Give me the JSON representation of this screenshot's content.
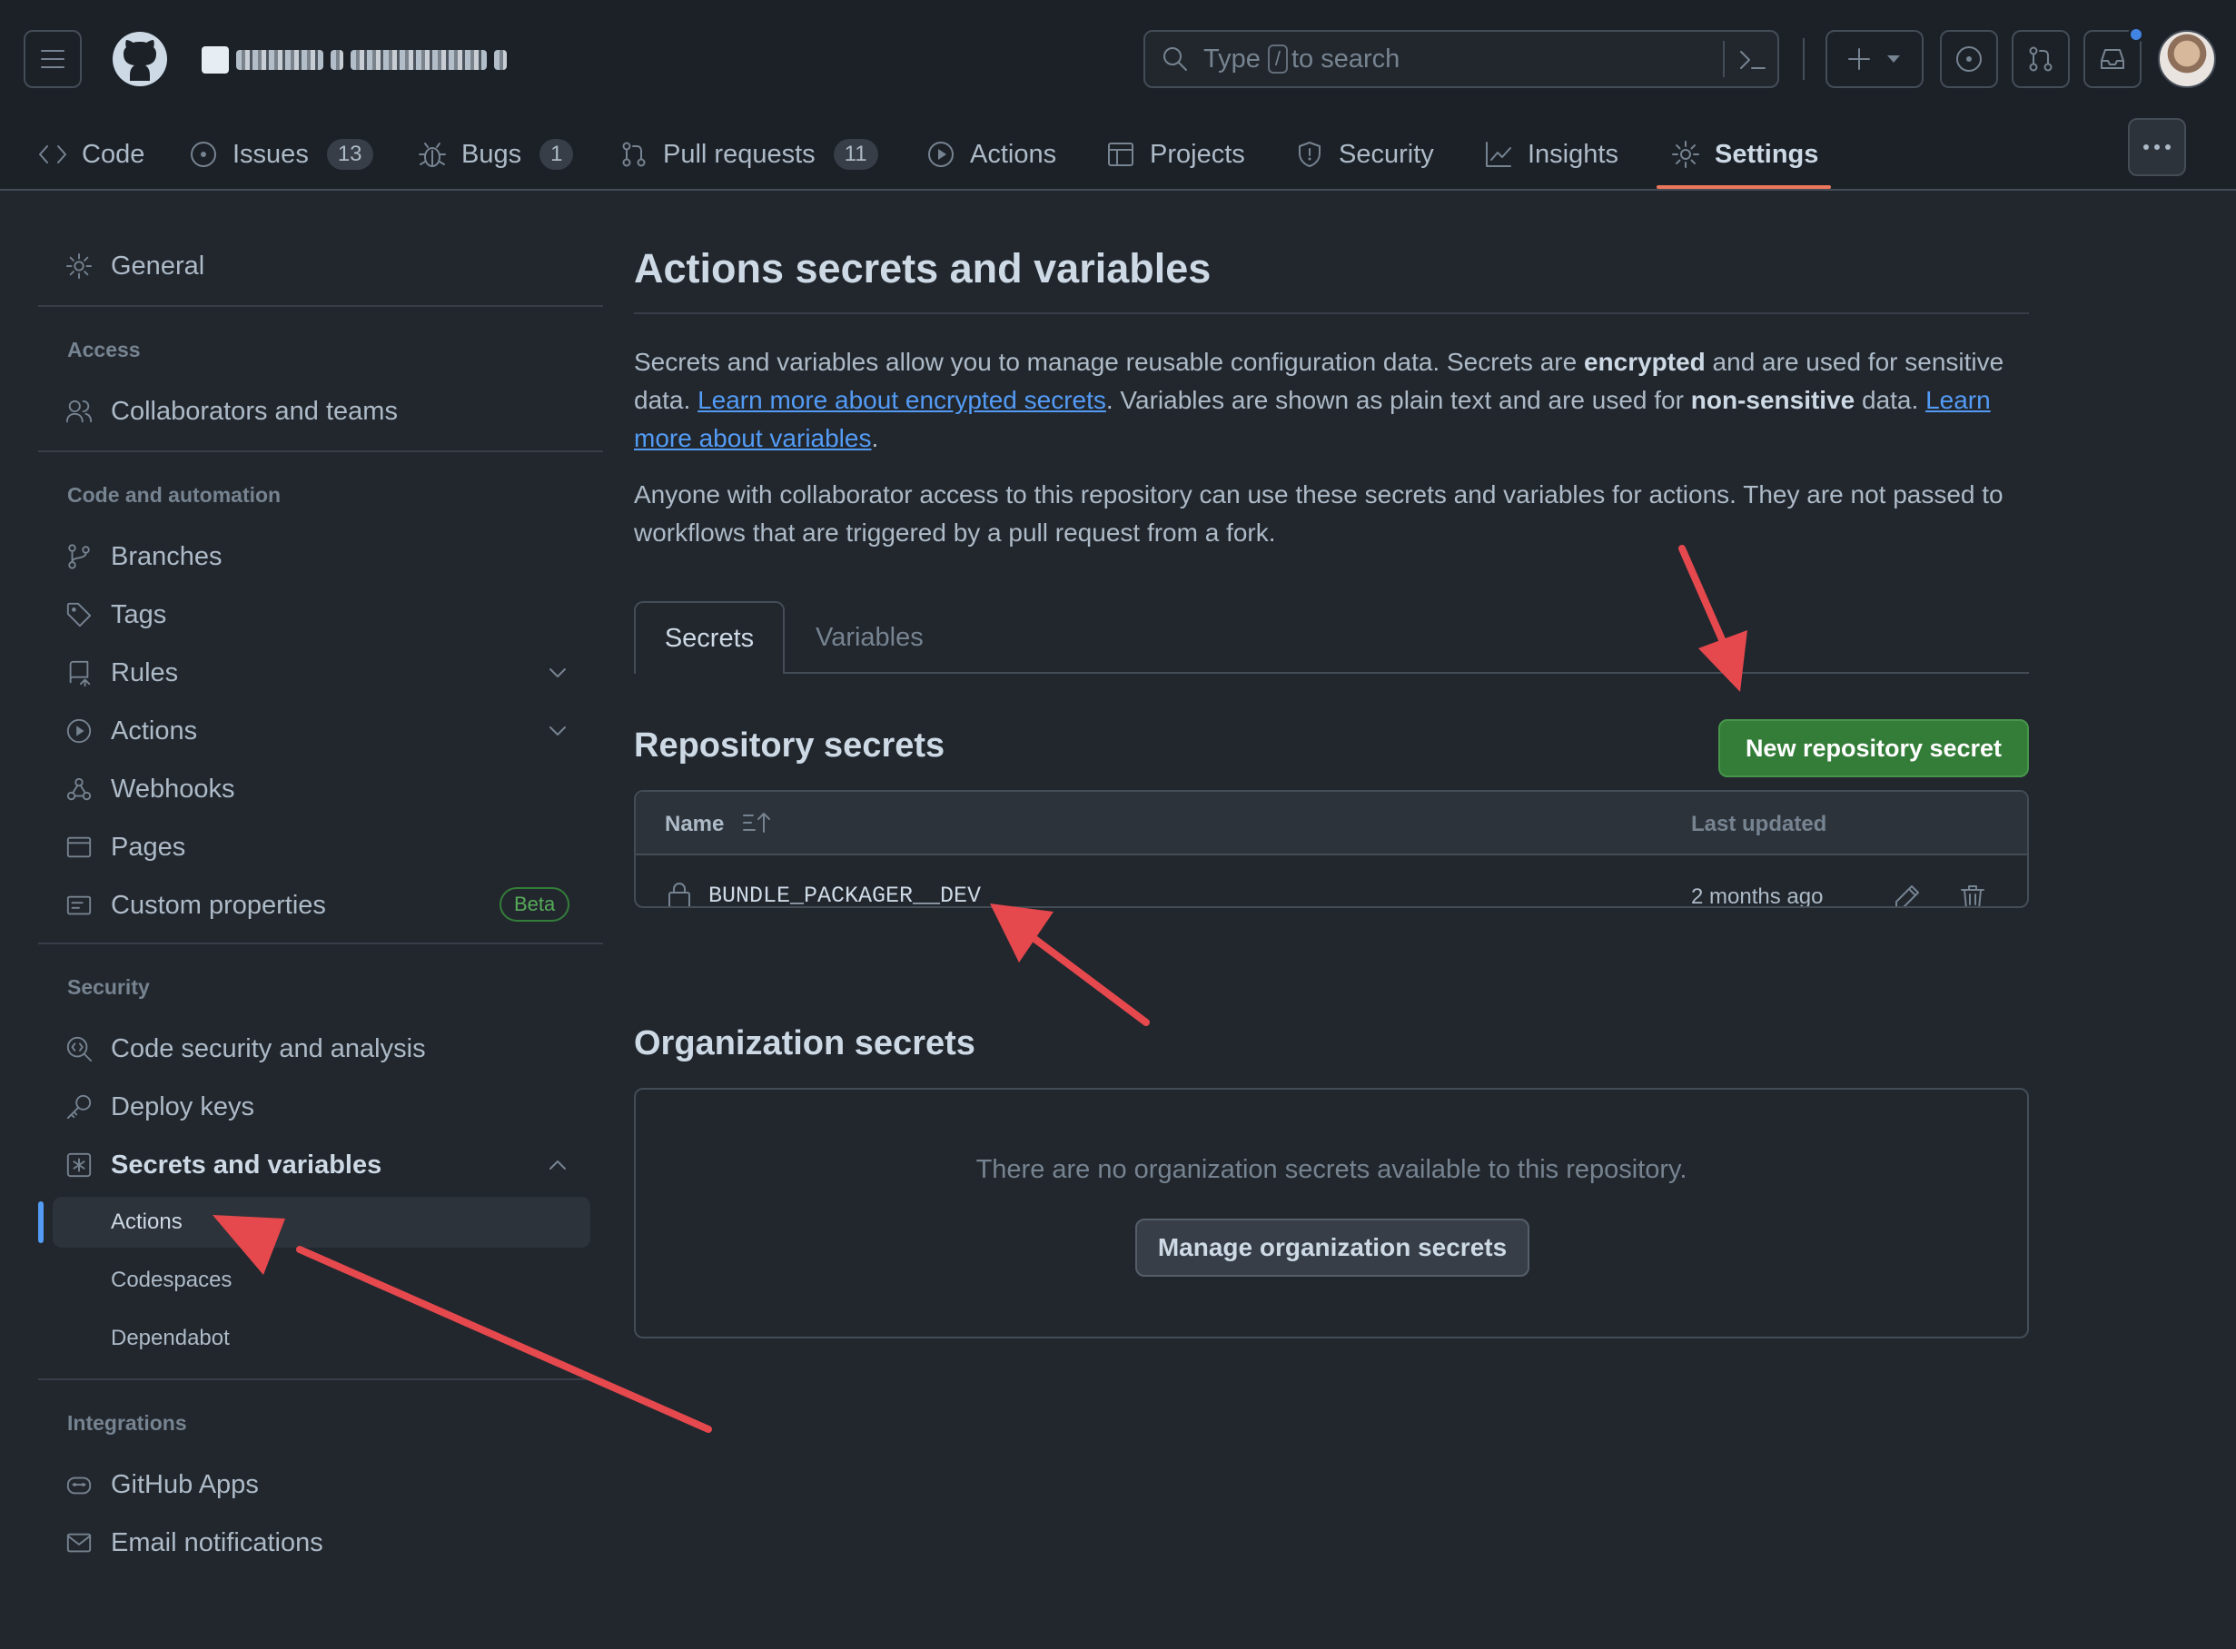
{
  "header": {
    "search_prefix": "Type",
    "search_slash": "/",
    "search_suffix": "to search",
    "icons": [
      "hamburger-icon",
      "github-logo-icon",
      "search-icon",
      "terminal-icon",
      "plus-icon",
      "issue-icon",
      "pull-request-icon",
      "inbox-icon",
      "avatar"
    ]
  },
  "repo_tabs": [
    {
      "label": "Code",
      "icon": "code-icon"
    },
    {
      "label": "Issues",
      "count": "13",
      "icon": "issue-icon"
    },
    {
      "label": "Bugs",
      "count": "1",
      "icon": "bug-icon"
    },
    {
      "label": "Pull requests",
      "count": "11",
      "icon": "pull-request-icon"
    },
    {
      "label": "Actions",
      "icon": "play-icon"
    },
    {
      "label": "Projects",
      "icon": "table-icon"
    },
    {
      "label": "Security",
      "icon": "shield-icon"
    },
    {
      "label": "Insights",
      "icon": "graph-icon"
    },
    {
      "label": "Settings",
      "icon": "gear-icon",
      "active": true
    }
  ],
  "sidebar": {
    "general": "General",
    "sections": {
      "access": "Access",
      "code_automation": "Code and automation",
      "security": "Security",
      "integrations": "Integrations"
    },
    "items": {
      "collaborators": "Collaborators and teams",
      "branches": "Branches",
      "tags": "Tags",
      "rules": "Rules",
      "actions": "Actions",
      "webhooks": "Webhooks",
      "pages": "Pages",
      "custom_properties": "Custom properties",
      "beta": "Beta",
      "code_security": "Code security and analysis",
      "deploy_keys": "Deploy keys",
      "secrets_variables": "Secrets and variables",
      "sub_actions": "Actions",
      "sub_codespaces": "Codespaces",
      "sub_dependabot": "Dependabot",
      "github_apps": "GitHub Apps",
      "email_notifications": "Email notifications"
    }
  },
  "main": {
    "title": "Actions secrets and variables",
    "p1_a": "Secrets and variables allow you to manage reusable configuration data. Secrets are ",
    "p1_b": "encrypted",
    "p1_c": " and are used for sensitive data. ",
    "p1_link1": "Learn more about encrypted secrets",
    "p1_d": ". Variables are shown as plain text and are used for ",
    "p1_e": "non-sensitive",
    "p1_f": " data. ",
    "p1_link2": "Learn more about variables",
    "p1_g": ".",
    "p2": "Anyone with collaborator access to this repository can use these secrets and variables for actions. They are not passed to workflows that are triggered by a pull request from a fork.",
    "tab_secrets": "Secrets",
    "tab_variables": "Variables",
    "repo_secrets_heading": "Repository secrets",
    "new_secret_button": "New repository secret",
    "table": {
      "col_name": "Name",
      "col_updated": "Last updated",
      "rows": [
        {
          "name": "BUNDLE_PACKAGER__DEV",
          "updated": "2 months ago"
        }
      ]
    },
    "org_secrets_heading": "Organization secrets",
    "org_empty": "There are no organization secrets available to this repository.",
    "manage_org_button": "Manage organization secrets"
  },
  "colors": {
    "background": "#22272e",
    "header": "#1c2128",
    "accent_green": "#347d39",
    "link": "#539bf5",
    "active_tab_underline": "#ec775c",
    "annotation_arrow": "#e5484d"
  }
}
